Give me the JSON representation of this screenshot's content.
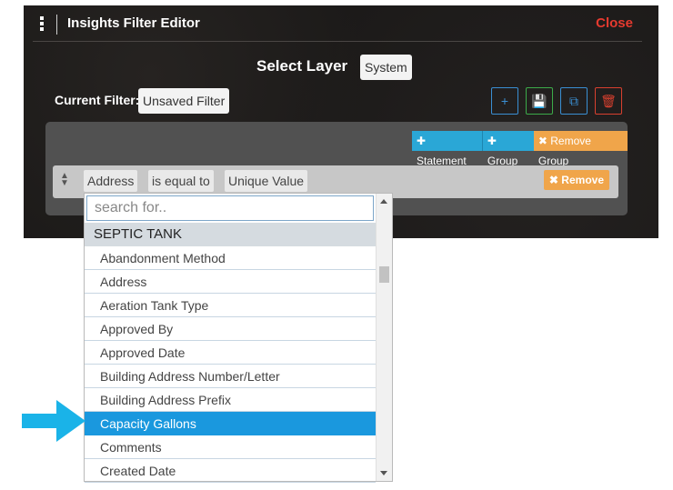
{
  "header": {
    "title": "Insights Filter Editor",
    "close_label": "Close"
  },
  "layer": {
    "label": "Select Layer",
    "value": "System"
  },
  "filter": {
    "label": "Current Filter:",
    "value": "Unsaved Filter"
  },
  "toolbar": [
    {
      "name": "add-filter-button",
      "icon": "plus-icon",
      "glyph": "+",
      "color": "#3a8fd3"
    },
    {
      "name": "save-filter-button",
      "icon": "save-icon",
      "glyph": "💾",
      "color": "#3cab4a"
    },
    {
      "name": "copy-filter-button",
      "icon": "copy-icon",
      "glyph": "⧉",
      "color": "#3a8fd3"
    },
    {
      "name": "delete-filter-button",
      "icon": "trash-icon",
      "glyph": "🗑",
      "color": "#d9402f"
    }
  ],
  "group_buttons": {
    "statement": "✚ Statement",
    "group": "✚ Group",
    "remove_group": "✖ Remove Group",
    "colors": {
      "statement": "#2aa7d6",
      "group": "#2aa7d6",
      "remove_group": "#f0a54a"
    }
  },
  "statement_row": {
    "field": "Address",
    "operator": "is equal to",
    "value_type": "Unique Value",
    "remove_label": "✖ Remove"
  },
  "dropdown": {
    "search_placeholder": "search for..",
    "group_label": "SEPTIC TANK",
    "options": [
      "Abandonment Method",
      "Address",
      "Aeration Tank Type",
      "Approved By",
      "Approved Date",
      "Building Address Number/Letter",
      "Building Address Prefix",
      "Capacity Gallons",
      "Comments",
      "Created Date"
    ],
    "selected_index": 7
  },
  "pointer": {
    "icon": "arrow-right-icon",
    "color": "#1ab3e8"
  }
}
